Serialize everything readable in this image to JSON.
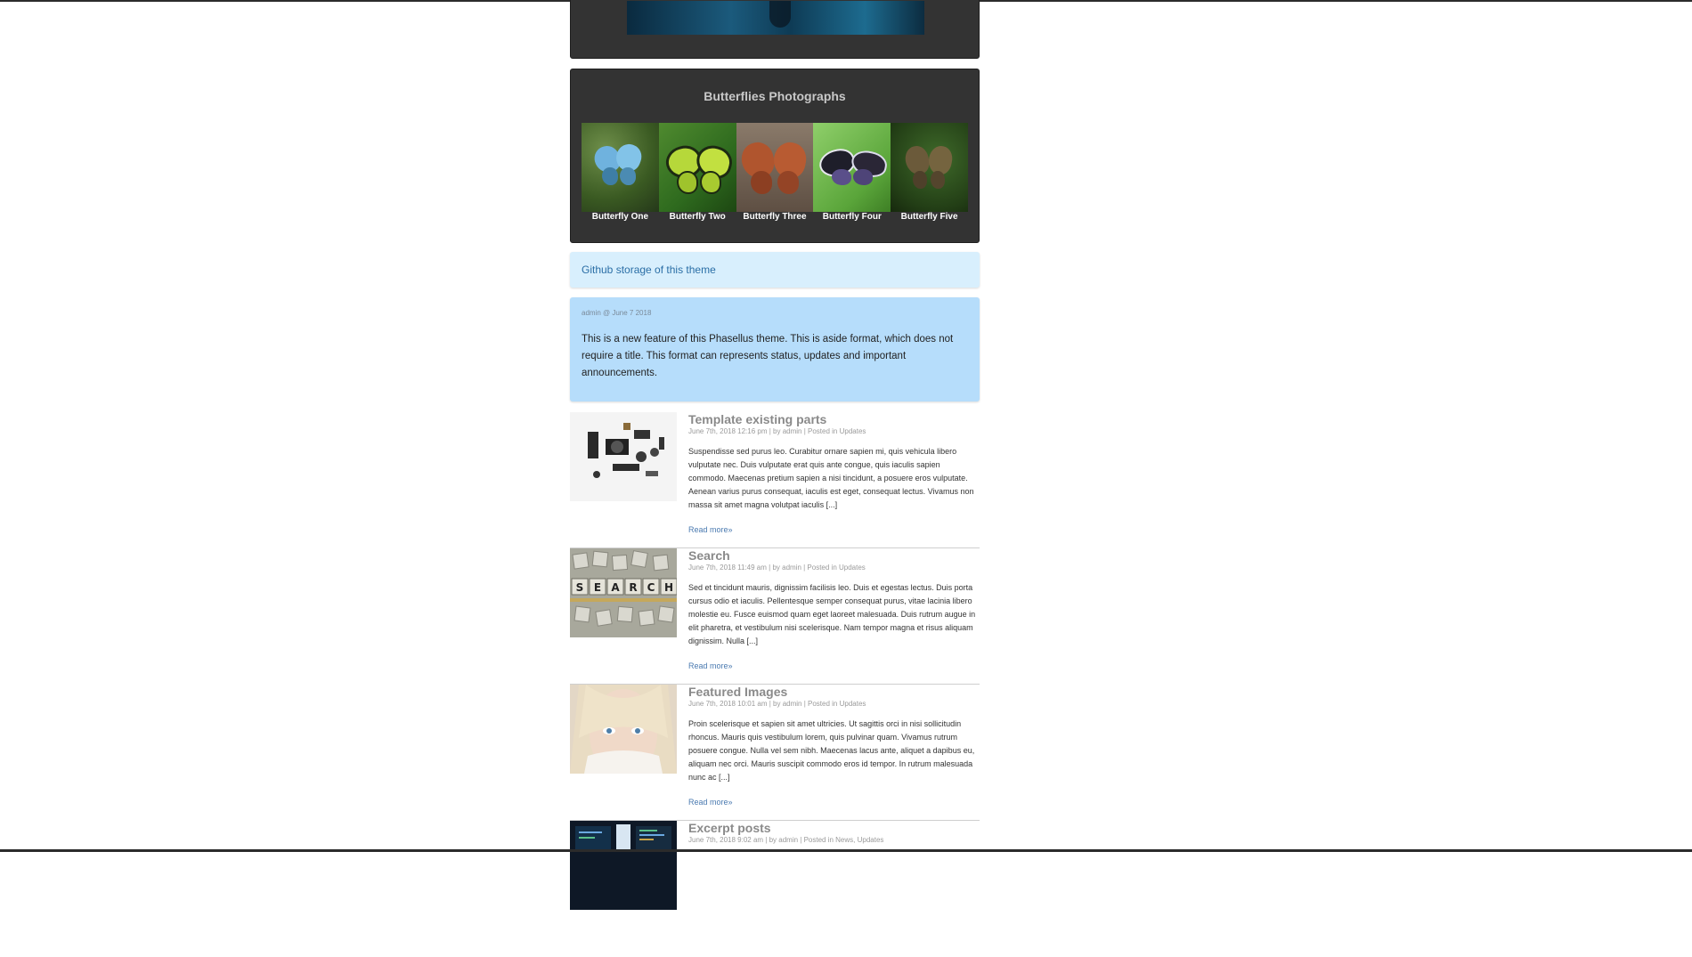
{
  "gallery": {
    "title": "Butterflies Photographs",
    "items": [
      {
        "caption": "Butterfly One"
      },
      {
        "caption": "Butterfly Two"
      },
      {
        "caption": "Butterfly Three"
      },
      {
        "caption": "Butterfly Four"
      },
      {
        "caption": "Butterfly Five"
      }
    ]
  },
  "link_box": {
    "text": "Github storage of this theme"
  },
  "aside": {
    "meta": "admin @ June 7 2018",
    "text": "This is a new feature of this Phasellus theme. This is aside format, which does not require a title. This format can represents status, updates and important announcements."
  },
  "posts": [
    {
      "title": "Template existing parts",
      "meta": "June 7th, 2018 12:16 pm | by admin | Posted in Updates",
      "excerpt": "Suspendisse sed purus leo. Curabitur ornare sapien mi, quis vehicula libero vulputate nec. Duis vulputate erat quis ante congue, quis iaculis sapien commodo. Maecenas pretium sapien a nisi tincidunt, a posuere eros vulputate. Aenean varius purus consequat, iaculis est eget, consequat lectus. Vivamus non massa sit amet magna volutpat iaculis [...]",
      "read_more": "Read more»"
    },
    {
      "title": "Search",
      "meta": "June 7th, 2018 11:49 am | by admin | Posted in Updates",
      "excerpt": "Sed et tincidunt mauris, dignissim facilisis leo. Duis et egestas lectus. Duis porta cursus odio et iaculis. Pellentesque semper consequat purus, vitae lacinia libero molestie eu. Fusce euismod quam eget laoreet malesuada. Duis rutrum augue in elit pharetra, et vestibulum nisi scelerisque. Nam tempor magna et risus aliquam dignissim. Nulla [...]",
      "read_more": "Read more»"
    },
    {
      "title": "Featured Images",
      "meta": "June 7th, 2018 10:01 am | by admin | Posted in Updates",
      "excerpt": "Proin scelerisque et sapien sit amet ultricies. Ut sagittis orci in nisi sollicitudin rhoncus. Mauris quis vestibulum lorem, quis pulvinar quam. Vivamus rutrum posuere congue. Nulla vel sem nibh. Maecenas lacus ante, aliquet a dapibus eu, aliquam nec orci. Mauris suscipit commodo eros id tempor. In rutrum malesuada nunc ac [...]",
      "read_more": "Read more»"
    },
    {
      "title": "Excerpt posts",
      "meta": "June 7th, 2018 9:02 am | by admin | Posted in News, Updates"
    }
  ],
  "search_tiles": [
    "S",
    "E",
    "A",
    "R",
    "C",
    "H"
  ]
}
